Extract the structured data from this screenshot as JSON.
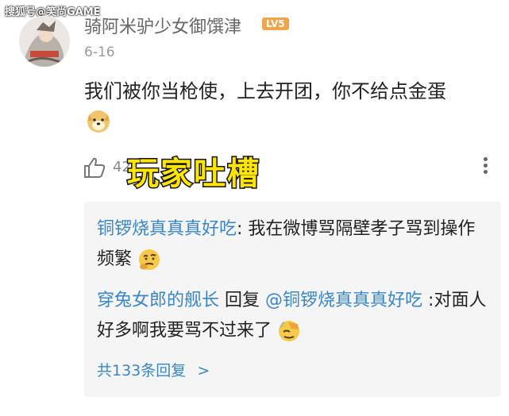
{
  "watermark": "搜狐号@笑尚GAME",
  "comment": {
    "username": "骑阿米驴少女御馔津",
    "level": "LV5",
    "date": "6-16",
    "text": "我们被你当枪使，上去开团，你不给点金蛋",
    "like_count": "42"
  },
  "overlay": {
    "title": "玩家吐槽"
  },
  "replies": [
    {
      "name": "铜锣烧真真真好吃",
      "separator": ": ",
      "text": "我在微博骂隔壁孝子骂到操作频繁"
    },
    {
      "name": "穿兔女郎的舰长",
      "reply_word": " 回复 ",
      "mention": "@铜锣烧真真真好吃",
      "separator": " :",
      "text": "对面人好多啊我要骂不过来了"
    }
  ],
  "more_replies": {
    "label": "共133条回复",
    "chevron": ">"
  },
  "icons": {
    "avatar": "user-avatar",
    "emoji1": "doge-emoji",
    "emoji2": "thinking-emoji",
    "emoji3": "facepalm-emoji",
    "like": "thumbs-up-icon",
    "more": "more-vertical-icon"
  }
}
